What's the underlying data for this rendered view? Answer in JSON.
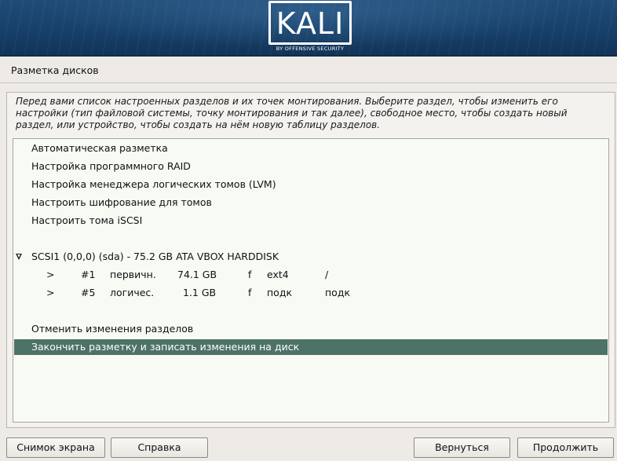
{
  "header": {
    "logo_text": "KALI",
    "logo_subtitle": "BY OFFENSIVE SECURITY"
  },
  "page": {
    "title": "Разметка дисков",
    "description": "Перед вами список настроенных разделов и их точек монтирования. Выберите раздел, чтобы изменить его настройки (тип файловой системы, точку монтирования и так далее), свободное место, чтобы создать новый раздел, или устройство, чтобы создать на нём новую таблицу разделов."
  },
  "list": {
    "options": [
      "Автоматическая разметка",
      "Настройка программного RAID",
      "Настройка менеджера логических томов (LVM)",
      "Настроить шифрование для томов",
      "Настроить тома iSCSI"
    ],
    "disk": "SCSI1 (0,0,0) (sda) - 75.2 GB ATA VBOX HARDDISK",
    "partitions": [
      {
        "arrow": ">",
        "num": "#1",
        "type": "первичн.",
        "size": "74.1 GB",
        "flag": "f",
        "fs": "ext4",
        "mount": "/"
      },
      {
        "arrow": ">",
        "num": "#5",
        "type": "логичес.",
        "size": "1.1 GB",
        "flag": "f",
        "fs": "подк",
        "mount": "подк"
      }
    ],
    "undo": "Отменить изменения разделов",
    "finish": "Закончить разметку и записать изменения на диск"
  },
  "buttons": {
    "screenshot": "Снимок экрана",
    "help": "Справка",
    "back": "Вернуться",
    "continue": "Продолжить"
  }
}
